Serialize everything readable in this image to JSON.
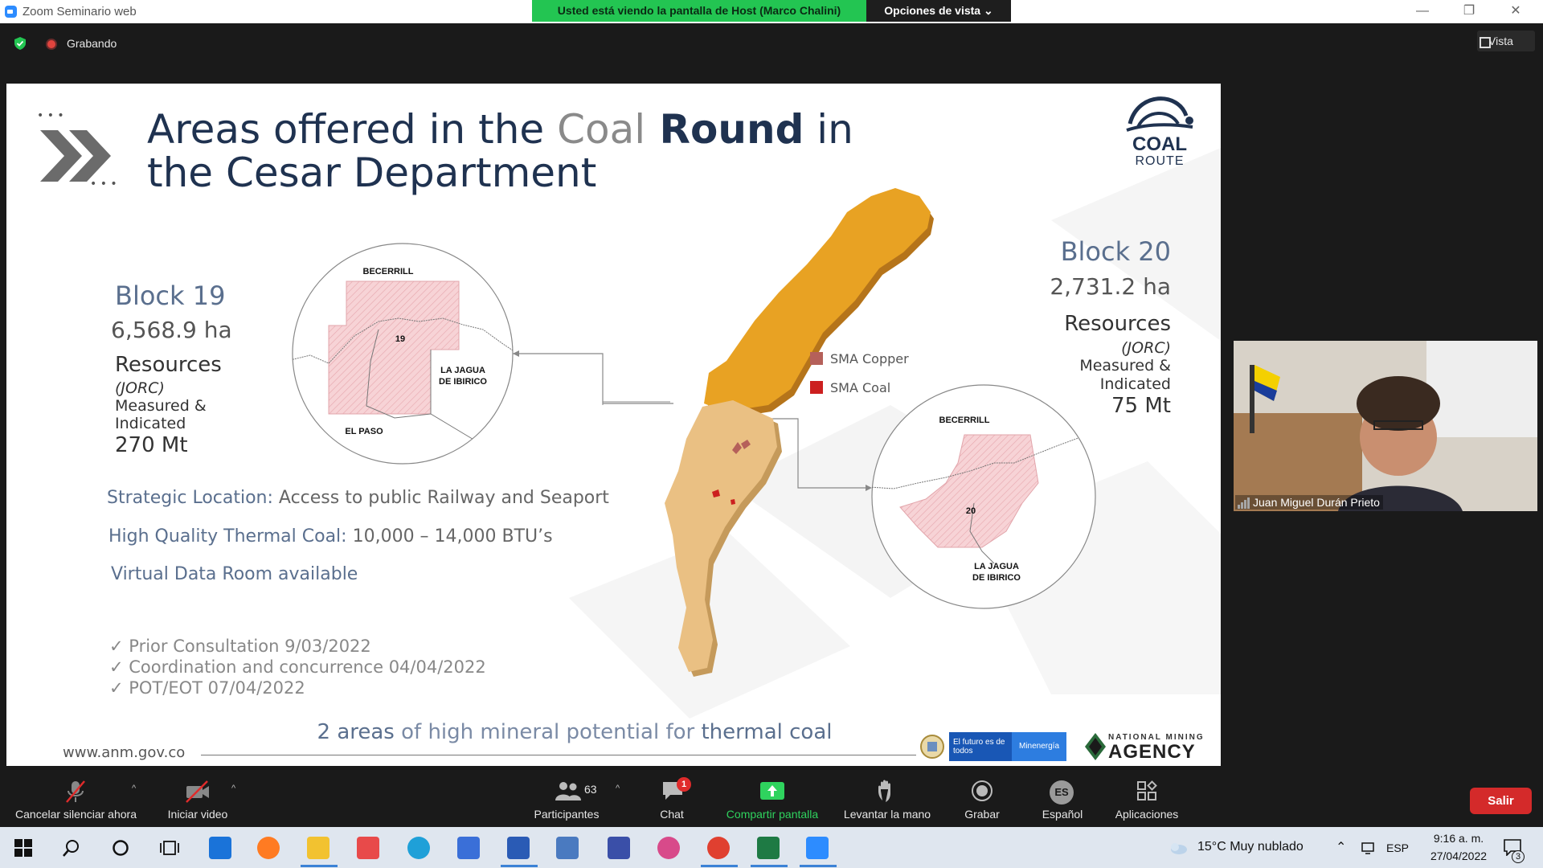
{
  "window": {
    "title": "Zoom Seminario web",
    "share_banner": "Usted está viendo la pantalla de Host (Marco Chalini)",
    "view_options": "Opciones de vista",
    "minimize": "—",
    "restore": "❐",
    "close": "✕"
  },
  "recording": {
    "label": "Grabando"
  },
  "view_button": "Vista",
  "slide": {
    "title_part1": "Areas offered in the ",
    "title_coal": "Coal",
    "title_round": " Round",
    "title_part2": " in the Cesar Department",
    "logo_coal": "COAL",
    "logo_route": "ROUTE",
    "block19": {
      "title": "Block 19",
      "area": "6,568.9 ha",
      "resources": "Resources",
      "jorc": "(JORC)",
      "measured": "Measured &",
      "indicated": "Indicated",
      "amount": "270 Mt"
    },
    "block20": {
      "title": "Block 20",
      "area": "2,731.2 ha",
      "resources": "Resources",
      "jorc": "(JORC)",
      "measured": "Measured &",
      "indicated": "Indicated",
      "amount": "75 Mt"
    },
    "map19": {
      "north": "BECERRILL",
      "number": "19",
      "east1": "LA JAGUA",
      "east2": "DE IBIRICO",
      "south": "EL PASO"
    },
    "map20": {
      "north": "BECERRILL",
      "number": "20",
      "south1": "LA JAGUA",
      "south2": "DE IBIRICO"
    },
    "legend": {
      "copper": "SMA Copper",
      "coal": "SMA Coal",
      "copper_color": "#b5605a",
      "coal_color": "#cc1f1f"
    },
    "features": {
      "strategic_label": "Strategic Location:",
      "strategic_value": " Access to public Railway and Seaport",
      "quality_label": "High Quality Thermal Coal:",
      "quality_value": " 10,000 – 14,000 BTU’s",
      "vdr": "Virtual Data Room available"
    },
    "milestones": [
      "✓ Prior Consultation 9/03/2022",
      "✓ Coordination and concurrence 04/04/2022",
      "✓ POT/EOT 07/04/2022"
    ],
    "bottom_num": "2",
    "bottom_areas": " areas ",
    "bottom_mid": "of high mineral potential for ",
    "bottom_thermal": "thermal coal",
    "url": "www.anm.gov.co",
    "gov_futuro": "El futuro es de todos",
    "gov_min": "Minenergía",
    "nma_small": "NATIONAL MINING",
    "nma_big": "AGENCY"
  },
  "video": {
    "name": "Juan Miguel Durán Prieto"
  },
  "toolbar": {
    "mute": "Cancelar silenciar ahora",
    "video": "Iniciar video",
    "participants": "Participantes",
    "participants_count": "63",
    "chat": "Chat",
    "chat_badge": "1",
    "share": "Compartir pantalla",
    "raise_hand": "Levantar la mano",
    "record": "Grabar",
    "language": "Español",
    "language_code": "ES",
    "apps": "Aplicaciones",
    "leave": "Salir"
  },
  "taskbar": {
    "weather": "15°C  Muy nublado",
    "lang": "ESP",
    "time": "9:16 a. m.",
    "date": "27/04/2022",
    "notif_count": "3"
  }
}
